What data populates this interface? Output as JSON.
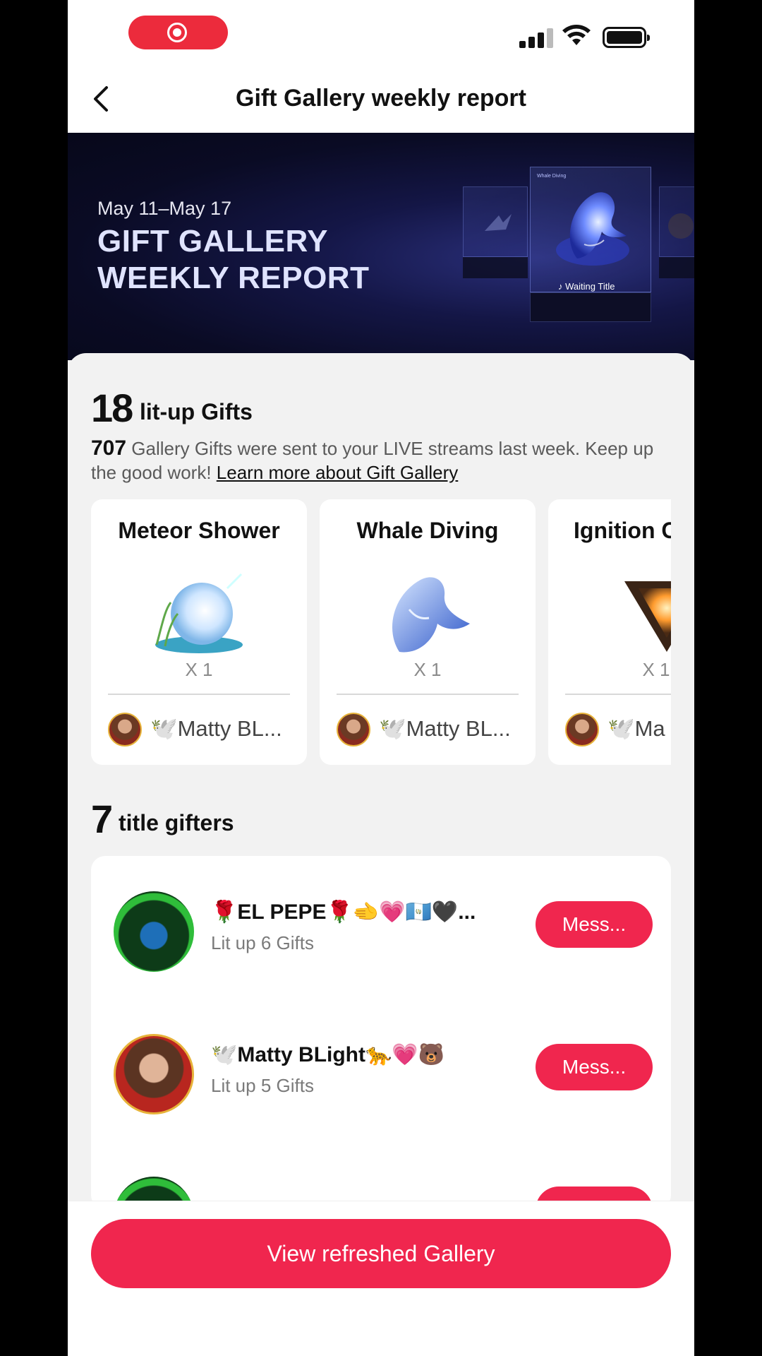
{
  "status_bar": {
    "recording_indicator": "screen-record-icon"
  },
  "nav": {
    "title": "Gift Gallery weekly report",
    "back_icon": "chevron-left-icon"
  },
  "banner": {
    "date_range": "May 11–May 17",
    "title": "GIFT GALLERY WEEKLY REPORT",
    "display_caption": "Waiting Title",
    "display_label": "Whale Diving"
  },
  "summary": {
    "lit_up_count": "18",
    "lit_up_label": "lit-up Gifts",
    "sent_count": "707",
    "sent_text": " Gallery Gifts were sent to your LIVE streams last week. Keep up the good work! ",
    "learn_more": "Learn more about Gift Gallery"
  },
  "gifts": [
    {
      "name": "Meteor Shower",
      "quantity": "X 1",
      "top_gifter": "🕊️Matty BL..."
    },
    {
      "name": "Whale Diving",
      "quantity": "X 1",
      "top_gifter": "🕊️Matty BL..."
    },
    {
      "name": "Ignition C",
      "quantity": "X 1",
      "top_gifter": "🕊️Ma"
    }
  ],
  "gifters_section": {
    "count": "7",
    "label": "title gifters"
  },
  "gifters": [
    {
      "name": "🌹EL PEPE🌹🫲💗🇬🇹🖤...",
      "subtitle": "Lit up 6 Gifts",
      "button": "Mess..."
    },
    {
      "name": "🕊️Matty BLight🐆💗🐻",
      "subtitle": "Lit up 5 Gifts",
      "button": "Mess..."
    },
    {
      "name": "",
      "subtitle": "",
      "button": ""
    }
  ],
  "footer": {
    "button_label": "View refreshed Gallery"
  },
  "colors": {
    "accent": "#f0264e",
    "record": "#ec2b3c",
    "banner_bg": "#0a0b24"
  }
}
